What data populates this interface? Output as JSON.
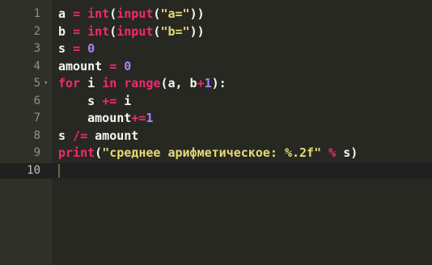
{
  "editor": {
    "colors": {
      "background": "#272822",
      "gutter": "#2f3129",
      "line_number": "#8f908a",
      "keyword": "#f92672",
      "string": "#e6db74",
      "number": "#ae81ff",
      "text": "#f8f8f2"
    },
    "active_line": 10,
    "lines": [
      {
        "n": "1",
        "tokens": [
          [
            "tx",
            "a "
          ],
          [
            "op",
            "="
          ],
          [
            "tx",
            " "
          ],
          [
            "fn",
            "int"
          ],
          [
            "pl",
            "("
          ],
          [
            "fn",
            "input"
          ],
          [
            "pl",
            "("
          ],
          [
            "str",
            "\"a=\""
          ],
          [
            "pl",
            "))"
          ]
        ]
      },
      {
        "n": "2",
        "tokens": [
          [
            "tx",
            "b "
          ],
          [
            "op",
            "="
          ],
          [
            "tx",
            " "
          ],
          [
            "fn",
            "int"
          ],
          [
            "pl",
            "("
          ],
          [
            "fn",
            "input"
          ],
          [
            "pl",
            "("
          ],
          [
            "str",
            "\"b=\""
          ],
          [
            "pl",
            "))"
          ]
        ]
      },
      {
        "n": "3",
        "tokens": [
          [
            "tx",
            "s "
          ],
          [
            "op",
            "="
          ],
          [
            "tx",
            " "
          ],
          [
            "num",
            "0"
          ]
        ]
      },
      {
        "n": "4",
        "tokens": [
          [
            "tx",
            "amount "
          ],
          [
            "op",
            "="
          ],
          [
            "tx",
            " "
          ],
          [
            "num",
            "0"
          ]
        ]
      },
      {
        "n": "5",
        "fold": "▾",
        "tokens": [
          [
            "kw",
            "for"
          ],
          [
            "tx",
            " i "
          ],
          [
            "kw",
            "in"
          ],
          [
            "tx",
            " "
          ],
          [
            "fn",
            "range"
          ],
          [
            "pl",
            "(a, b"
          ],
          [
            "op",
            "+"
          ],
          [
            "num",
            "1"
          ],
          [
            "pl",
            "):"
          ]
        ]
      },
      {
        "n": "6",
        "tokens": [
          [
            "tx",
            "    s "
          ],
          [
            "op",
            "+="
          ],
          [
            "tx",
            " i"
          ]
        ]
      },
      {
        "n": "7",
        "tokens": [
          [
            "tx",
            "    amount"
          ],
          [
            "op",
            "+="
          ],
          [
            "num",
            "1"
          ]
        ]
      },
      {
        "n": "8",
        "tokens": [
          [
            "tx",
            "s "
          ],
          [
            "op",
            "/="
          ],
          [
            "tx",
            " amount"
          ]
        ]
      },
      {
        "n": "9",
        "tokens": [
          [
            "fn",
            "print"
          ],
          [
            "pl",
            "("
          ],
          [
            "str",
            "\"среднее арифметическое: %.2f\""
          ],
          [
            "tx",
            " "
          ],
          [
            "op",
            "%"
          ],
          [
            "tx",
            " s)"
          ]
        ]
      },
      {
        "n": "10",
        "tokens": []
      }
    ]
  }
}
